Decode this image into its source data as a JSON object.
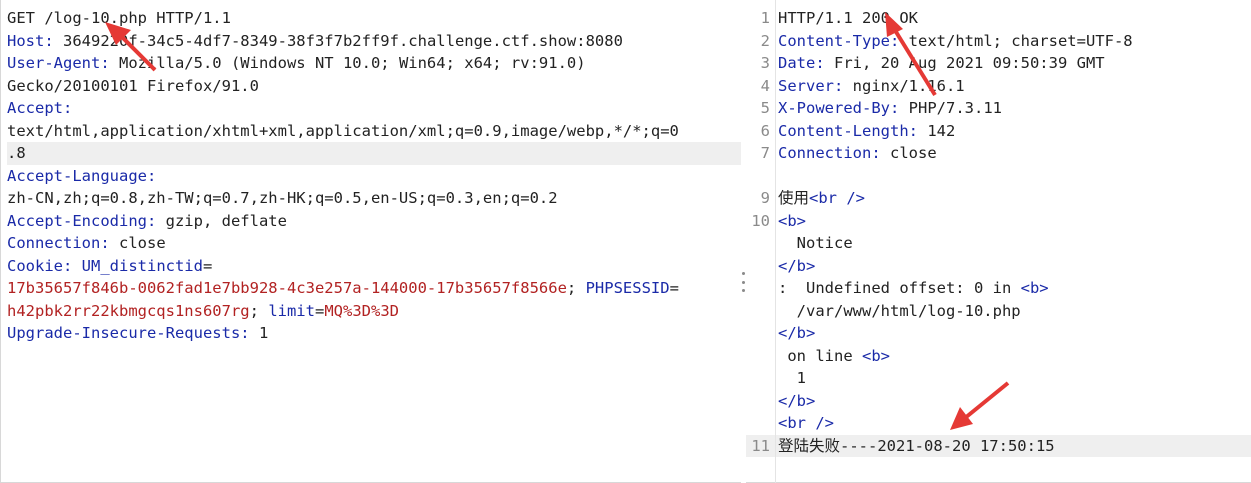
{
  "request": {
    "line1": "GET /log-10.php HTTP/1.1",
    "host_key": "Host:",
    "host_val": " 3649220f-34c5-4df7-8349-38f3f7b2ff9f.challenge.ctf.show:8080",
    "ua_key": "User-Agent:",
    "ua_val": " Mozilla/5.0 (Windows NT 10.0; Win64; x64; rv:91.0)",
    "ua_cont": "Gecko/20100101 Firefox/91.0",
    "accept_key": "Accept:",
    "accept_val1": "text/html,application/xhtml+xml,application/xml;q=0.9,image/webp,*/*;q=0",
    "accept_val2": ".8",
    "lang_key": "Accept-Language:",
    "lang_val": "zh-CN,zh;q=0.8,zh-TW;q=0.7,zh-HK;q=0.5,en-US;q=0.3,en;q=0.2",
    "enc_key": "Accept-Encoding:",
    "enc_val": " gzip, deflate",
    "conn_key": "Connection:",
    "conn_val": " close",
    "cookie_key": "Cookie:",
    "cookie_name1": " UM_distinctid",
    "cookie_eq1": "=",
    "cookie_val1a": "17b35657f846b-0062fad1e7bb928-4c3e257a-144000-17b35657f8566e",
    "cookie_sep1": "; ",
    "cookie_name2": "PHPSESSID",
    "cookie_eq2": "=",
    "cookie_val2": "h42pbk2rr22kbmgcqs1ns607rg",
    "cookie_sep2": "; ",
    "cookie_name3": "limit",
    "cookie_eq3": "=",
    "cookie_val3": "MQ%3D%3D",
    "upg_key": "Upgrade-Insecure-Requests:",
    "upg_val": " 1"
  },
  "response": {
    "n1": "1",
    "n2": "2",
    "n3": "3",
    "n4": "4",
    "n5": "5",
    "n6": "6",
    "n7": "7",
    "n9": "9",
    "n10": "10",
    "n11": "11",
    "status": "HTTP/1.1 200 OK",
    "ct_key": "Content-Type:",
    "ct_val": " text/html; charset=UTF-8",
    "date_key": "Date:",
    "date_val": " Fri, 20 Aug 2021 09:50:39 GMT",
    "server_key": "Server:",
    "server_val": " nginx/1.16.1",
    "xpb_key": "X-Powered-By:",
    "xpb_val": " PHP/7.3.11",
    "cl_key": "Content-Length:",
    "cl_val": " 142",
    "conn_key": "Connection:",
    "conn_val": " close",
    "body_use": "使用",
    "tag_br": "<br />",
    "tag_b_open": "<b>",
    "tag_b_close": "</b>",
    "notice": "  Notice",
    "undefined_prefix": ":  Undefined offset: 0 in ",
    "path": "  /var/www/html/log-10.php",
    "on_line": " on line ",
    "line_no": "  1",
    "final_line": "登陆失败----2021-08-20 17:50:15"
  }
}
